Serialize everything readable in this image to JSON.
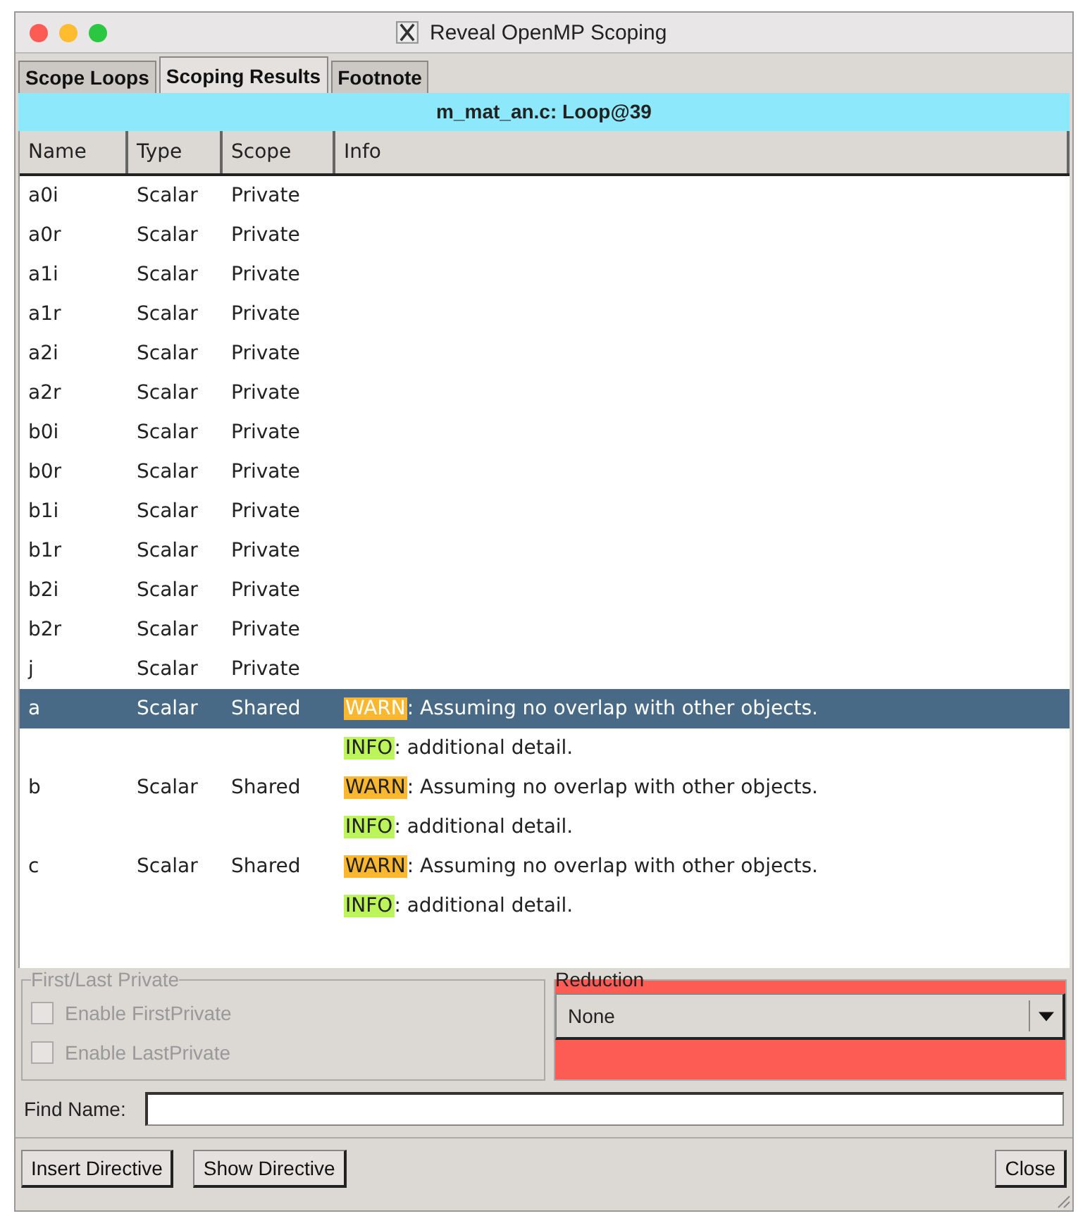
{
  "window": {
    "title": "Reveal OpenMP Scoping"
  },
  "tabs": [
    {
      "label": "Scope Loops",
      "selected": false
    },
    {
      "label": "Scoping Results",
      "selected": true
    },
    {
      "label": "Footnote",
      "selected": false
    }
  ],
  "banner": "m_mat_an.c: Loop@39",
  "table": {
    "columns": [
      "Name",
      "Type",
      "Scope",
      "Info"
    ],
    "rows": [
      {
        "name": "a0i",
        "type": "Scalar",
        "scope": "Private",
        "selected": false
      },
      {
        "name": "a0r",
        "type": "Scalar",
        "scope": "Private",
        "selected": false
      },
      {
        "name": "a1i",
        "type": "Scalar",
        "scope": "Private",
        "selected": false
      },
      {
        "name": "a1r",
        "type": "Scalar",
        "scope": "Private",
        "selected": false
      },
      {
        "name": "a2i",
        "type": "Scalar",
        "scope": "Private",
        "selected": false
      },
      {
        "name": "a2r",
        "type": "Scalar",
        "scope": "Private",
        "selected": false
      },
      {
        "name": "b0i",
        "type": "Scalar",
        "scope": "Private",
        "selected": false
      },
      {
        "name": "b0r",
        "type": "Scalar",
        "scope": "Private",
        "selected": false
      },
      {
        "name": "b1i",
        "type": "Scalar",
        "scope": "Private",
        "selected": false
      },
      {
        "name": "b1r",
        "type": "Scalar",
        "scope": "Private",
        "selected": false
      },
      {
        "name": "b2i",
        "type": "Scalar",
        "scope": "Private",
        "selected": false
      },
      {
        "name": "b2r",
        "type": "Scalar",
        "scope": "Private",
        "selected": false
      },
      {
        "name": "j",
        "type": "Scalar",
        "scope": "Private",
        "selected": false
      },
      {
        "name": "a",
        "type": "Scalar",
        "scope": "Shared",
        "info": {
          "kind": "warn",
          "tag": "WARN",
          "text": ": Assuming no overlap with other objects."
        },
        "selected": true
      },
      {
        "info": {
          "kind": "info",
          "tag": "INFO",
          "text": ": additional detail."
        },
        "selected": false
      },
      {
        "name": "b",
        "type": "Scalar",
        "scope": "Shared",
        "info": {
          "kind": "warn",
          "tag": "WARN",
          "text": ": Assuming no overlap with other objects."
        },
        "selected": false
      },
      {
        "info": {
          "kind": "info",
          "tag": "INFO",
          "text": ": additional detail."
        },
        "selected": false
      },
      {
        "name": "c",
        "type": "Scalar",
        "scope": "Shared",
        "info": {
          "kind": "warn",
          "tag": "WARN",
          "text": ": Assuming no overlap with other objects."
        },
        "selected": false
      },
      {
        "info": {
          "kind": "info",
          "tag": "INFO",
          "text": ": additional detail."
        },
        "selected": false
      }
    ]
  },
  "first_last_private": {
    "title": "First/Last Private",
    "disabled": true,
    "options": [
      {
        "label": "Enable FirstPrivate",
        "checked": false
      },
      {
        "label": "Enable LastPrivate",
        "checked": false
      }
    ]
  },
  "reduction": {
    "title": "Reduction",
    "value": "None"
  },
  "find": {
    "label": "Find Name:"
  },
  "buttons": [
    "Insert Directive",
    "Show Directive"
  ],
  "close_button": "Close"
}
